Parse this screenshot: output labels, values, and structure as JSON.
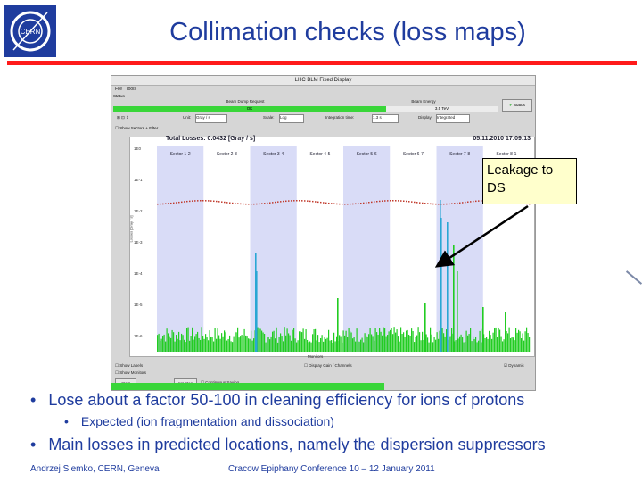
{
  "slide": {
    "title": "Collimation checks (loss maps)",
    "logo_text": "CERN",
    "callout": "Leakage to DS",
    "bullets": [
      {
        "text": "Lose about a factor 50-100 in cleaning efficiency for ions cf protons",
        "level": 1
      },
      {
        "text": "Expected (ion fragmentation and dissociation)",
        "level": 2
      },
      {
        "text": "Main losses in predicted locations, namely the dispersion suppressors",
        "level": 1
      }
    ],
    "bullet_l1": "•",
    "bullet_l2": "•",
    "footer_left": "Andrzej Siemko, CERN, Geneva",
    "footer_center": "Cracow Epiphany Conference   10 – 12 January 2011"
  },
  "app": {
    "window_title": "LHC BLM Fixed Display",
    "menu": [
      "File",
      "Tools"
    ],
    "status_label": "Status",
    "beam_dump_label": "Beam Dump Request",
    "beam_dump_value": "OK",
    "beam_energy_label": "Beam Energy",
    "beam_energy_value": "3.5 TeV",
    "status_button": "Status",
    "toolbar": {
      "unit_label": "Unit:",
      "unit_value": "Gray / s",
      "scale_label": "Scale:",
      "scale_value": "Log",
      "integration_label": "Integration time:",
      "integration_value": "1.3 s",
      "display_label": "Display:",
      "display_value": "Integrated"
    },
    "show_sectors_label": "Show Sectors + Filter",
    "plot_title": "Total Losses: 0.0432 [Gray / s]",
    "plot_date": "05.11.2010 17:09:13",
    "y_axis_label": "Losses [Gray / s]",
    "x_axis_label": "Monitors",
    "sectors": [
      "Sector 1-2",
      "Sector 2-3",
      "Sector 3-4",
      "Sector 4-5",
      "Sector 5-6",
      "Sector 6-7",
      "Sector 7-8",
      "Sector 8-1"
    ],
    "y_ticks": [
      "1E0",
      "1E-1",
      "1E-2",
      "1E-3",
      "1E-4",
      "1E-5",
      "1E-6"
    ],
    "buttons": {
      "start": "Start",
      "step": "1st Step",
      "continuous": "Continuous Saving"
    },
    "checkboxes": {
      "show_labels": "Show Labels",
      "show_monitors": "Show Monitors",
      "display_gain": "Display Gain / Channels",
      "dynamic": "Dynamic"
    }
  },
  "colors": {
    "title": "#1f3c9e",
    "rule": "#ff1a1a",
    "loss_bars": "#22cc22",
    "highlight": "#2aa7d4",
    "threshold": "#c0392b",
    "sector_shade": "#d9dcf7"
  }
}
